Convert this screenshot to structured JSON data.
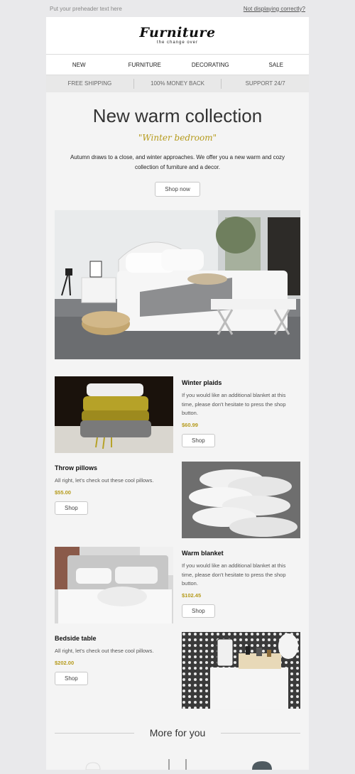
{
  "preheader": {
    "left": "Put your preheader text here",
    "right": "Not displaying correctly?"
  },
  "logo": {
    "title": "Furniture",
    "tagline": "the change over"
  },
  "nav": [
    "NEW",
    "FURNITURE",
    "DECORATING",
    "SALE"
  ],
  "benefits": [
    "FREE SHIPPING",
    "100% MONEY BACK",
    "SUPPORT 24/7"
  ],
  "hero": {
    "title": "New warm collection",
    "subtitle": "\"Winter bedroom\"",
    "text": "Autumn draws to a close, and winter approaches. We offer you a new warm and cozy collection of furniture and a decor.",
    "button": "Shop now"
  },
  "products": [
    {
      "name": "Winter plaids",
      "desc": "If you would like an additional blanket at this time, please don't hesitate to press the shop button.",
      "price": "$60.99",
      "button": "Shop",
      "image": "knitted-plaids-photo"
    },
    {
      "name": "Throw pillows",
      "desc": "All right, let's check out these cool pillows.",
      "price": "$55.00",
      "button": "Shop",
      "image": "white-pillows-photo"
    },
    {
      "name": "Warm blanket",
      "desc": "If you would like an additional blanket at this time, please don't hesitate to press the shop button.",
      "price": "$102.45",
      "button": "Shop",
      "image": "bed-blanket-photo"
    },
    {
      "name": "Bedside table",
      "desc": "All right, let's check out these cool pillows.",
      "price": "$202.00",
      "button": "Shop",
      "image": "bedside-table-photo"
    }
  ],
  "more": {
    "title": "More for you"
  },
  "colors": {
    "accent": "#b59a1a",
    "background": "#e9e9eb",
    "panel": "#f4f4f4"
  }
}
